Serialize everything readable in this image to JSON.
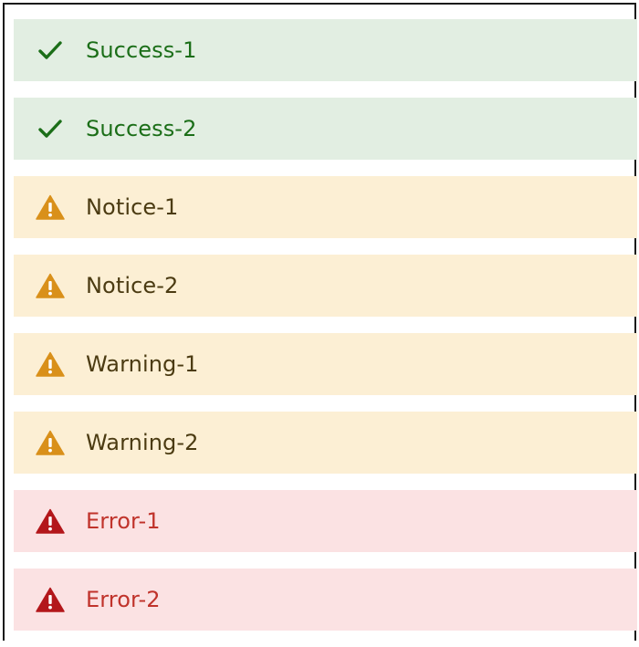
{
  "messages": [
    {
      "type": "success",
      "label": "Success-1",
      "icon": "checkmark-icon"
    },
    {
      "type": "success",
      "label": "Success-2",
      "icon": "checkmark-icon"
    },
    {
      "type": "notice",
      "label": "Notice-1",
      "icon": "warning-triangle-icon"
    },
    {
      "type": "notice",
      "label": "Notice-2",
      "icon": "warning-triangle-icon"
    },
    {
      "type": "warning",
      "label": "Warning-1",
      "icon": "warning-triangle-icon"
    },
    {
      "type": "warning",
      "label": "Warning-2",
      "icon": "warning-triangle-icon"
    },
    {
      "type": "error",
      "label": "Error-1",
      "icon": "error-triangle-icon"
    },
    {
      "type": "error",
      "label": "Error-2",
      "icon": "error-triangle-icon"
    }
  ],
  "colors": {
    "success_bg": "#e2eee2",
    "success_text": "#1b6e18",
    "notice_bg": "#fcefd4",
    "notice_text": "#4b3b12",
    "warning_icon": "#d9901a",
    "error_bg": "#fbe2e3",
    "error_text": "#c0332b",
    "error_icon": "#b3171b"
  }
}
